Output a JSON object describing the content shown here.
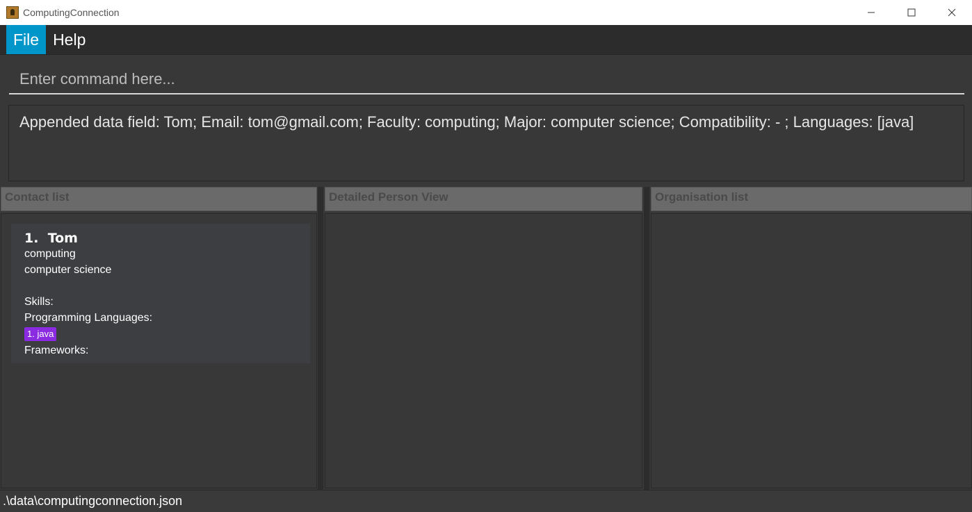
{
  "window": {
    "title": "ComputingConnection",
    "app_icon": "contact-book-icon",
    "controls": [
      "minimize-icon",
      "maximize-icon",
      "close-icon"
    ]
  },
  "menu": {
    "items": [
      {
        "label": "File",
        "active": true
      },
      {
        "label": "Help",
        "active": false
      }
    ]
  },
  "command": {
    "placeholder": "Enter command here...",
    "value": ""
  },
  "result": {
    "text": "Appended data field: Tom; Email: tom@gmail.com; Faculty: computing; Major: computer science; Compatibility:  - ; Languages: [java]"
  },
  "panels": {
    "contact_list": {
      "title": "Contact list"
    },
    "detail_view": {
      "title": "Detailed Person View"
    },
    "organisation_list": {
      "title": "Organisation list"
    }
  },
  "contacts": [
    {
      "index": "1.",
      "name": "Tom",
      "faculty": "computing",
      "major": "computer science",
      "skills_label": "Skills:",
      "languages_label": "Programming Languages:",
      "languages": [
        "1. java"
      ],
      "frameworks_label": "Frameworks:"
    }
  ],
  "status": {
    "path": ".\\data\\computingconnection.json"
  },
  "colors": {
    "accent": "#0096c9",
    "tag": "#8a2be2",
    "background": "#383838"
  }
}
